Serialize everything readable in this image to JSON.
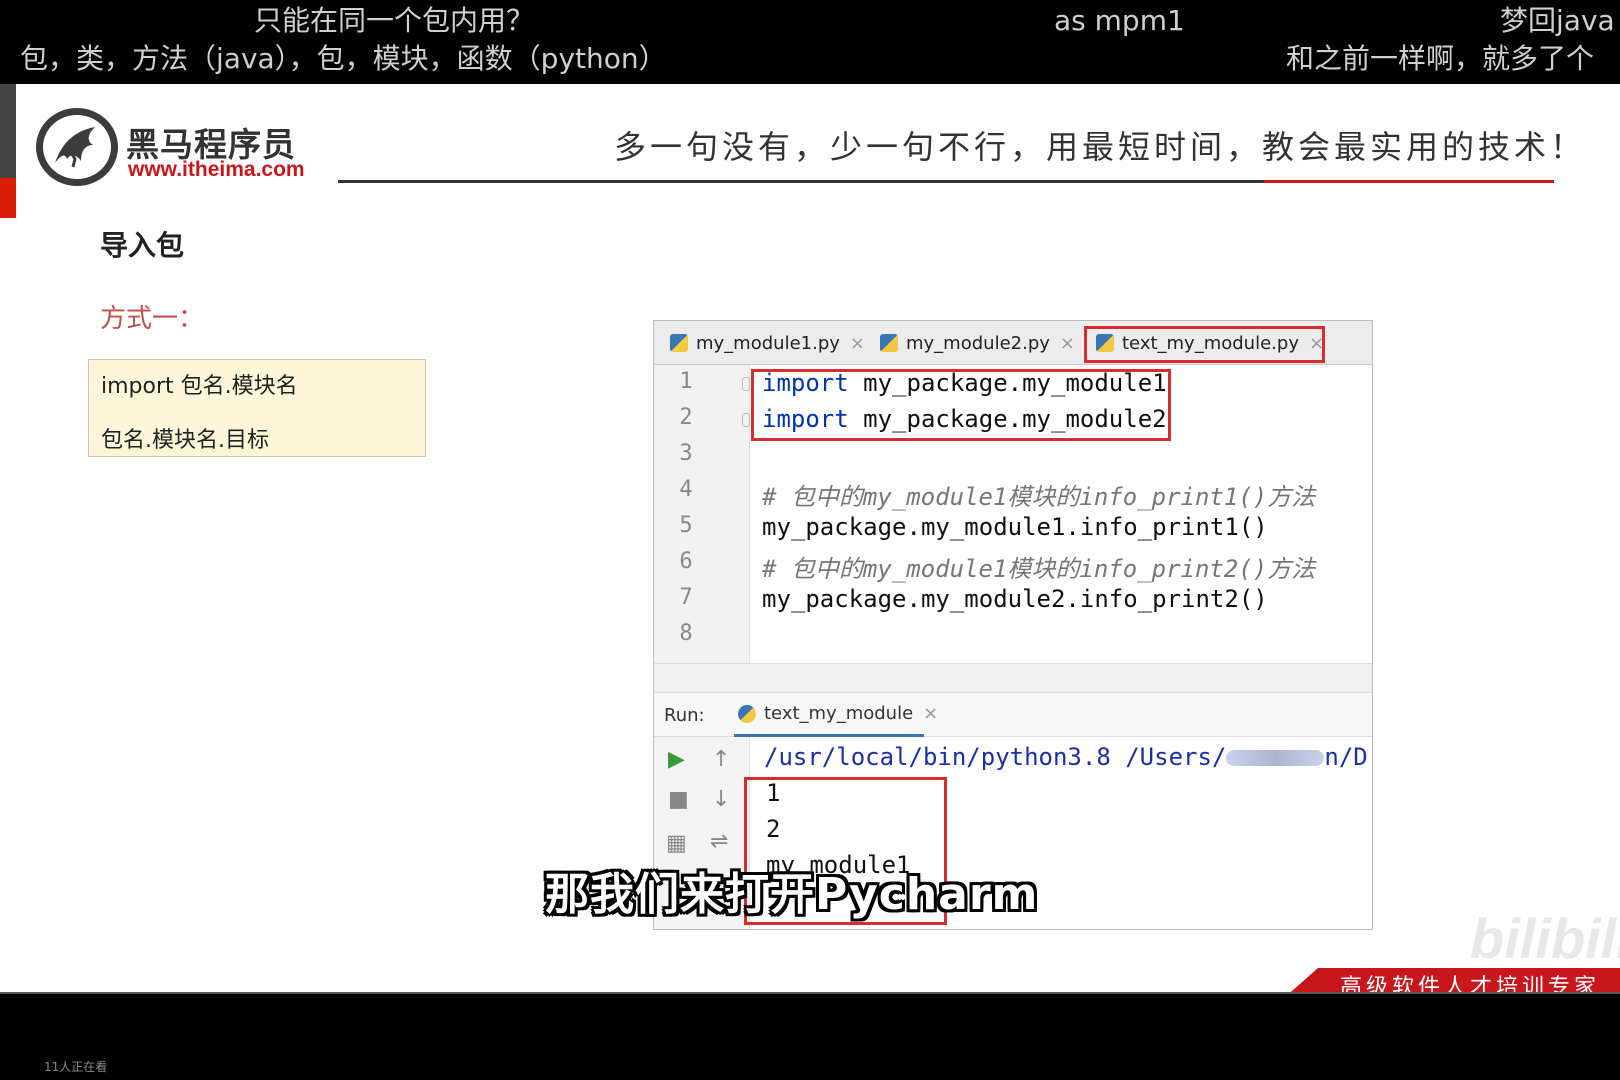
{
  "danmaku": [
    {
      "text": "只能在同一个包内用？"
    },
    {
      "text": "as  mpm1"
    },
    {
      "text": "梦回java"
    },
    {
      "text": "包，类，方法（java），包，模块，函数（python）"
    },
    {
      "text": "和之前一样啊，就多了个"
    }
  ],
  "slide": {
    "logo_title": "黑马程序员",
    "logo_url": "www.itheima.com",
    "slogan": "多一句没有，少一句不行，用最短时间，教会最实用的技术！",
    "section_title": "导入包",
    "method_label": "方式一：",
    "code_box": {
      "line1": "import 包名.模块名",
      "line2": "包名.模块名.目标"
    },
    "banner": "高级软件人才培训专家",
    "watermark": "bilibili"
  },
  "ide": {
    "tabs": [
      {
        "label": "my_module1.py"
      },
      {
        "label": "my_module2.py"
      },
      {
        "label": "text_my_module.py"
      }
    ],
    "line_numbers": [
      "1",
      "2",
      "3",
      "4",
      "5",
      "6",
      "7",
      "8"
    ],
    "code_lines": {
      "l1_kw": "import",
      "l1_rest": " my_package.my_module1",
      "l2_kw": "import",
      "l2_rest": " my_package.my_module2",
      "l4": "# 包中的my_module1模块的info_print1()方法",
      "l5": "my_package.my_module1.info_print1()",
      "l6": "# 包中的my_module1模块的info_print2()方法",
      "l7": "my_package.my_module2.info_print2()"
    },
    "run": {
      "label": "Run:",
      "tab": "text_my_module",
      "path_start": "/usr/local/bin/python3.8 /Users/",
      "path_end": "n/D",
      "output": [
        "1",
        "2",
        "my_module1"
      ]
    }
  },
  "subtitle": "那我们来打开Pycharm",
  "viewers": "11人正在看"
}
